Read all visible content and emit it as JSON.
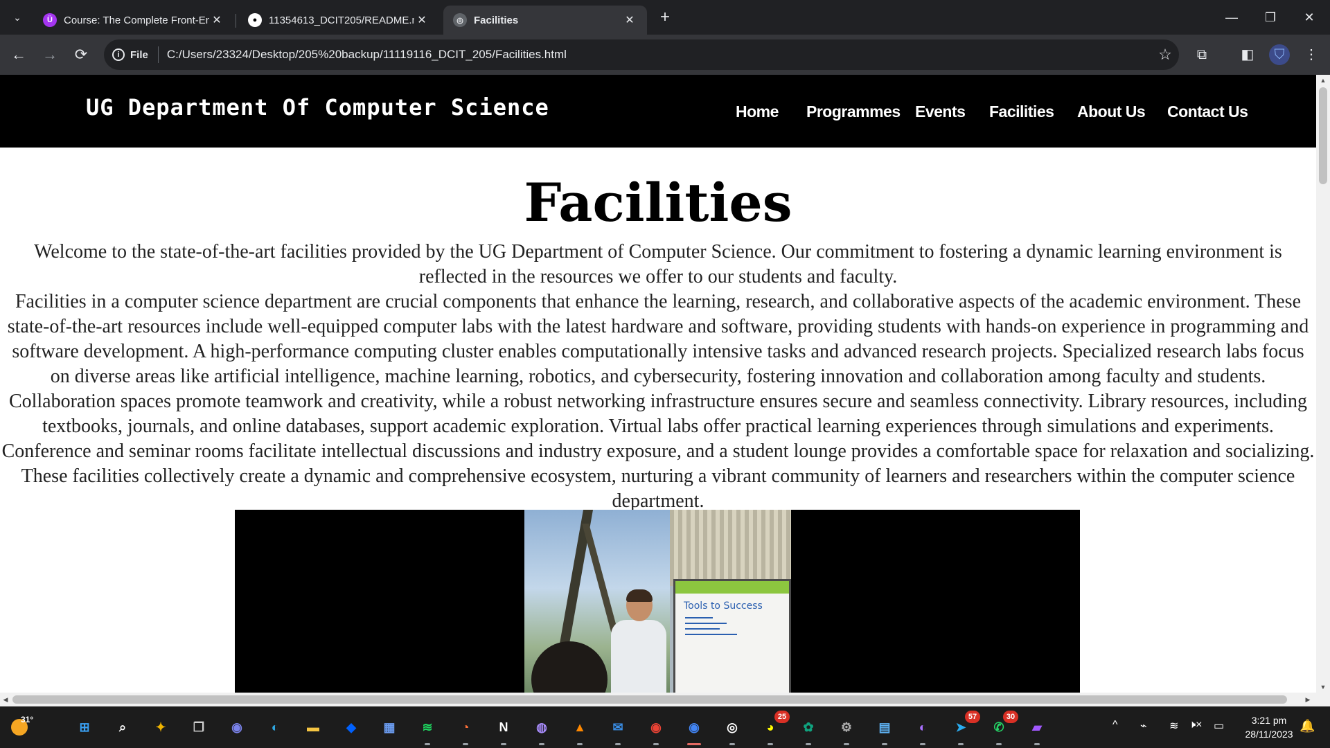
{
  "browser": {
    "tabs": [
      {
        "title": "Course: The Complete Front-En",
        "favicon_color": "#a435f0",
        "favicon_glyph": "Ü",
        "active": false
      },
      {
        "title": "11354613_DCIT205/README.m",
        "favicon_color": "#ffffff",
        "favicon_glyph": "●",
        "active": false
      },
      {
        "title": "Facilities",
        "favicon_color": "#9aa0a6",
        "favicon_glyph": "◎",
        "active": true
      }
    ],
    "new_tab_label": "+",
    "window_controls": {
      "minimize": "—",
      "restore": "❐",
      "close": "✕"
    },
    "nav": {
      "back": "←",
      "forward": "→",
      "reload": "⟳"
    },
    "omnibox": {
      "chip_info": "i",
      "chip_label": "File",
      "url": "C:/Users/23324/Desktop/205%20backup/11119116_DCIT_205/Facilities.html",
      "star": "☆"
    },
    "toolbar_icons": {
      "extensions": "⧉",
      "sidepanel": "◧",
      "profile": "⛉",
      "menu": "⋮"
    }
  },
  "site": {
    "brand": "UG Department Of Computer Science",
    "nav": [
      "Home",
      "Programmes",
      "Events",
      "Facilities",
      "About Us",
      "Contact Us"
    ],
    "title": "Facilities",
    "intro": "Welcome to the state-of-the-art facilities provided by the UG Department of Computer Science. Our commitment to fostering a dynamic learning environment is reflected in the resources we offer to our students and faculty.",
    "body": "Facilities in a computer science department are crucial components that enhance the learning, research, and collaborative aspects of the academic environment. These state-of-the-art resources include well-equipped computer labs with the latest hardware and software, providing students with hands-on experience in programming and software development. A high-performance computing cluster enables computationally intensive tasks and advanced research projects. Specialized research labs focus on diverse areas like artificial intelligence, machine learning, robotics, and cybersecurity, fostering innovation and collaboration among faculty and students. Collaboration spaces promote teamwork and creativity, while a robust networking infrastructure ensures secure and seamless connectivity. Library resources, including textbooks, journals, and online databases, support academic exploration. Virtual labs offer practical learning experiences through simulations and experiments. Conference and seminar rooms facilitate intellectual discussions and industry exposure, and a student lounge provides a comfortable space for relaxation and socializing. These facilities collectively create a dynamic and comprehensive ecosystem, nurturing a vibrant community of learners and researchers within the computer science department.",
    "video_whiteboard_text": "Tools to Success"
  },
  "taskbar": {
    "weather_temp": "31°",
    "apps": [
      {
        "name": "start-menu",
        "glyph": "⊞",
        "color": "#3aa0f3",
        "badge": ""
      },
      {
        "name": "search",
        "glyph": "⌕",
        "color": "#ffffff",
        "badge": ""
      },
      {
        "name": "copilot",
        "glyph": "✦",
        "color": "#f0b400",
        "badge": ""
      },
      {
        "name": "task-view",
        "glyph": "❐",
        "color": "#d0d0d0",
        "badge": ""
      },
      {
        "name": "teams-chat",
        "glyph": "◉",
        "color": "#7b83eb",
        "badge": ""
      },
      {
        "name": "edge",
        "glyph": "◐",
        "color": "#2ea6e0",
        "badge": ""
      },
      {
        "name": "file-explorer",
        "glyph": "▬",
        "color": "#f5c542",
        "badge": ""
      },
      {
        "name": "dropbox",
        "glyph": "◆",
        "color": "#0061fe",
        "badge": ""
      },
      {
        "name": "microsoft-store",
        "glyph": "▦",
        "color": "#6b9cf0",
        "badge": ""
      },
      {
        "name": "spotify",
        "glyph": "≋",
        "color": "#1ed760",
        "badge": ""
      },
      {
        "name": "firefox",
        "glyph": "◔",
        "color": "#ff7139",
        "badge": ""
      },
      {
        "name": "notion",
        "glyph": "N",
        "color": "#ffffff",
        "badge": ""
      },
      {
        "name": "game-controller",
        "glyph": "◍",
        "color": "#a78bfa",
        "badge": ""
      },
      {
        "name": "vlc",
        "glyph": "▲",
        "color": "#ff8800",
        "badge": ""
      },
      {
        "name": "mail",
        "glyph": "✉",
        "color": "#3a8ee6",
        "badge": ""
      },
      {
        "name": "chrome",
        "glyph": "◉",
        "color": "#ea4335",
        "badge": ""
      },
      {
        "name": "chrome-active",
        "glyph": "◉",
        "color": "#4285f4",
        "badge": ""
      },
      {
        "name": "obs-studio",
        "glyph": "◎",
        "color": "#ffffff",
        "badge": ""
      },
      {
        "name": "snapchat",
        "glyph": "◕",
        "color": "#fffc00",
        "badge": "25"
      },
      {
        "name": "chatgpt",
        "glyph": "✿",
        "color": "#10a37f",
        "badge": ""
      },
      {
        "name": "settings",
        "glyph": "⚙",
        "color": "#b0b0b0",
        "badge": ""
      },
      {
        "name": "notepad",
        "glyph": "▤",
        "color": "#5fb3f5",
        "badge": ""
      },
      {
        "name": "github-desktop",
        "glyph": "◐",
        "color": "#a970ff",
        "badge": ""
      },
      {
        "name": "telegram",
        "glyph": "➤",
        "color": "#2aabee",
        "badge": "57"
      },
      {
        "name": "whatsapp",
        "glyph": "✆",
        "color": "#25d366",
        "badge": "30"
      },
      {
        "name": "clipchamp",
        "glyph": "▰",
        "color": "#a259ff",
        "badge": ""
      }
    ],
    "tray": {
      "chevron": "^",
      "network": "⌁",
      "wifi": "≋",
      "volume": "🕨×",
      "battery": "▭"
    },
    "clock_time": "3:21 pm",
    "clock_date": "28/11/2023"
  }
}
